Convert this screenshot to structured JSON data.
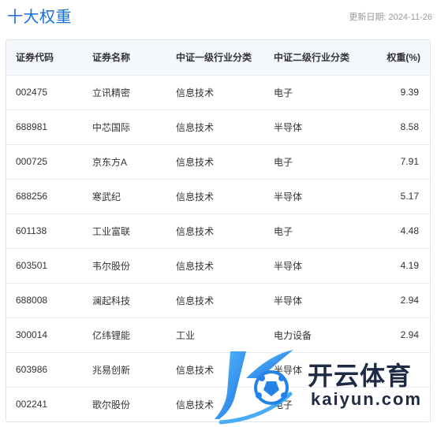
{
  "header": {
    "title": "十大权重",
    "update_label": "更新日期:",
    "update_date": "2024-11-26"
  },
  "table": {
    "columns": [
      "证券代码",
      "证券名称",
      "中证一级行业分类",
      "中证二级行业分类",
      "权重(%)"
    ],
    "rows": [
      {
        "code": "002475",
        "name": "立讯精密",
        "l1": "信息技术",
        "l2": "电子",
        "weight": "9.39"
      },
      {
        "code": "688981",
        "name": "中芯国际",
        "l1": "信息技术",
        "l2": "半导体",
        "weight": "8.58"
      },
      {
        "code": "000725",
        "name": "京东方A",
        "l1": "信息技术",
        "l2": "电子",
        "weight": "7.91"
      },
      {
        "code": "688256",
        "name": "寒武纪",
        "l1": "信息技术",
        "l2": "半导体",
        "weight": "5.17"
      },
      {
        "code": "601138",
        "name": "工业富联",
        "l1": "信息技术",
        "l2": "电子",
        "weight": "4.48"
      },
      {
        "code": "603501",
        "name": "韦尔股份",
        "l1": "信息技术",
        "l2": "半导体",
        "weight": "4.19"
      },
      {
        "code": "688008",
        "name": "澜起科技",
        "l1": "信息技术",
        "l2": "半导体",
        "weight": "2.94"
      },
      {
        "code": "300014",
        "name": "亿纬锂能",
        "l1": "工业",
        "l2": "电力设备",
        "weight": "2.94"
      },
      {
        "code": "603986",
        "name": "兆易创新",
        "l1": "信息技术",
        "l2": "半导体",
        "weight": ""
      },
      {
        "code": "002241",
        "name": "歌尔股份",
        "l1": "信息技术",
        "l2": "电子",
        "weight": ""
      }
    ]
  },
  "watermark": {
    "brand": "开云体育",
    "url": "kaiyun.com",
    "logo_icon": "k-soccer-ball-logo"
  },
  "colors": {
    "title": "#1a6fd6",
    "header_bg": "#f4f7fb",
    "border": "#dfe5ee"
  }
}
